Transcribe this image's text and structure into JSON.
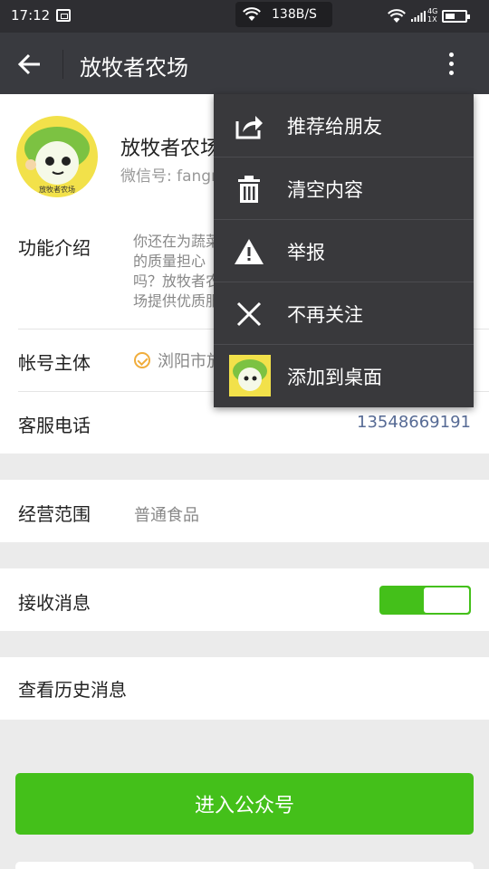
{
  "status_bar": {
    "time": "17:12",
    "net_speed": "138B/S",
    "network_type": "4G",
    "sim_info": "1X"
  },
  "titlebar": {
    "title": "放牧者农场"
  },
  "profile": {
    "name": "放牧者农场",
    "wechat_id": "微信号: fangmuzhe",
    "avatar_text": "放牧者农场"
  },
  "info": {
    "intro_label": "功能介绍",
    "intro_text": "你还在为蔬菜的质量担心吗？放牧者农场提供优质服务，让您足不出户吃到新鲜无公害蔬菜",
    "entity_label": "帐号主体",
    "entity_value": "浏阳市放牧者农场",
    "phone_label": "客服电话",
    "phone_value": "13548669191",
    "scope_label": "经营范围",
    "scope_value": "普通食品",
    "receive_label": "接收消息",
    "receive_enabled": true,
    "history_label": "查看历史消息"
  },
  "enter_button": "进入公众号",
  "menu": {
    "items": [
      {
        "label": "推荐给朋友",
        "icon": "share-icon"
      },
      {
        "label": "清空内容",
        "icon": "trash-icon"
      },
      {
        "label": "举报",
        "icon": "warning-icon"
      },
      {
        "label": "不再关注",
        "icon": "close-icon"
      },
      {
        "label": "添加到桌面",
        "icon": "app-thumbnail"
      }
    ]
  },
  "colors": {
    "accent_green": "#44c01a",
    "titlebar": "#393a3f",
    "menu_bg": "#39393c",
    "link_blue": "#576b95"
  }
}
